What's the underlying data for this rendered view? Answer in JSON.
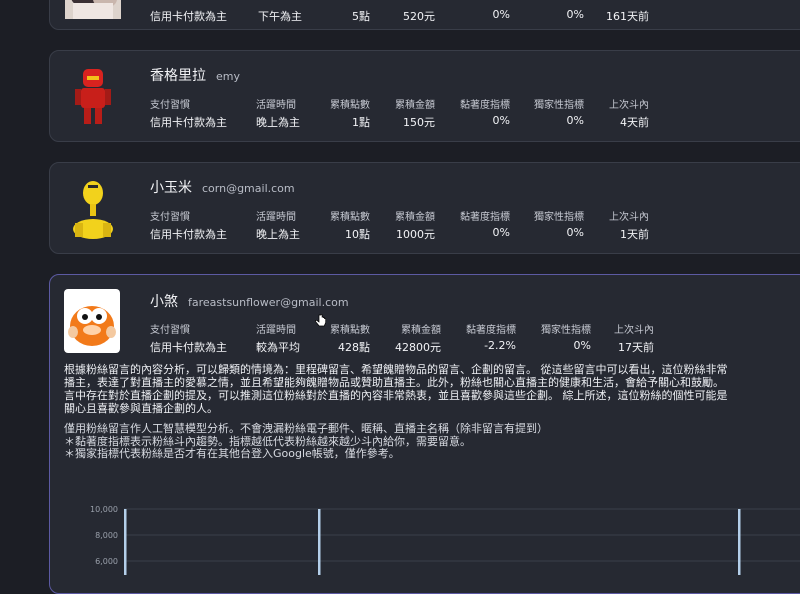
{
  "fans": [
    {
      "name": "",
      "email": "",
      "stats": [
        {
          "label": "",
          "value": "信用卡付款為主"
        },
        {
          "label": "",
          "value": "下午為主"
        },
        {
          "label": "",
          "value": "5點"
        },
        {
          "label": "",
          "value": "520元"
        },
        {
          "label": "",
          "value": "0%"
        },
        {
          "label": "",
          "value": "0%"
        },
        {
          "label": "",
          "value": "161天前"
        }
      ]
    },
    {
      "name": "香格里拉",
      "email": "emy",
      "stats": [
        {
          "label": "支付習慣",
          "value": "信用卡付款為主"
        },
        {
          "label": "活躍時間",
          "value": "晚上為主"
        },
        {
          "label": "累積點數",
          "value": "1點"
        },
        {
          "label": "累積金額",
          "value": "150元"
        },
        {
          "label": "黏著度指標",
          "value": "0%"
        },
        {
          "label": "獨家性指標",
          "value": "0%"
        },
        {
          "label": "上次斗內",
          "value": "4天前"
        }
      ]
    },
    {
      "name": "小玉米",
      "email": "corn@gmail.com",
      "stats": [
        {
          "label": "支付習慣",
          "value": "信用卡付款為主"
        },
        {
          "label": "活躍時間",
          "value": "晚上為主"
        },
        {
          "label": "累積點數",
          "value": "10點"
        },
        {
          "label": "累積金額",
          "value": "1000元"
        },
        {
          "label": "黏著度指標",
          "value": "0%"
        },
        {
          "label": "獨家性指標",
          "value": "0%"
        },
        {
          "label": "上次斗內",
          "value": "1天前"
        }
      ]
    },
    {
      "name": "小煞",
      "email": "fareastsunflower@gmail.com",
      "stats": [
        {
          "label": "支付習慣",
          "value": "信用卡付款為主"
        },
        {
          "label": "活躍時間",
          "value": "較為平均"
        },
        {
          "label": "累積點數",
          "value": "428點"
        },
        {
          "label": "累積金額",
          "value": "42800元"
        },
        {
          "label": "黏著度指標",
          "value": "-2.2%"
        },
        {
          "label": "獨家性指標",
          "value": "0%"
        },
        {
          "label": "上次斗內",
          "value": "17天前"
        }
      ]
    }
  ],
  "analysis": {
    "lines": [
      "根據粉絲留言的內容分析，可以歸類的情境為：里程碑留言、希望餽贈物品的留言、企劃的留言。 從這些留言中可以看出，這位粉絲非常",
      "播主，表達了對直播主的愛慕之情，並且希望能夠餽贈物品或贊助直播主。此外，粉絲也關心直播主的健康和生活，會給予關心和鼓勵。",
      "言中存在對於直播企劃的提及，可以推測這位粉絲對於直播的內容非常熱衷，並且喜歡參與這些企劃。 綜上所述，這位粉絲的個性可能是",
      "關心且喜歡參與直播企劃的人。"
    ]
  },
  "notes": [
    "僅用粉絲留言作人工智慧模型分析。不會洩漏粉絲電子郵件、暱稱、直播主名稱（除非留言有提到）",
    "＊黏著度指標表示粉絲斗內趨勢。指標越低代表粉絲越來越少斗內給你，需要留意。",
    "＊獨家指標代表粉絲是否才有在其他台登入Google帳號，僅作參考。"
  ],
  "chart_data": {
    "type": "bar",
    "y_ticks": [
      "10,000",
      "8,000",
      "6,000"
    ],
    "ylim": [
      6000,
      10000
    ],
    "series": [],
    "colors": {
      "bar": "#b4cfea",
      "grid": "#3b3f4a"
    }
  }
}
